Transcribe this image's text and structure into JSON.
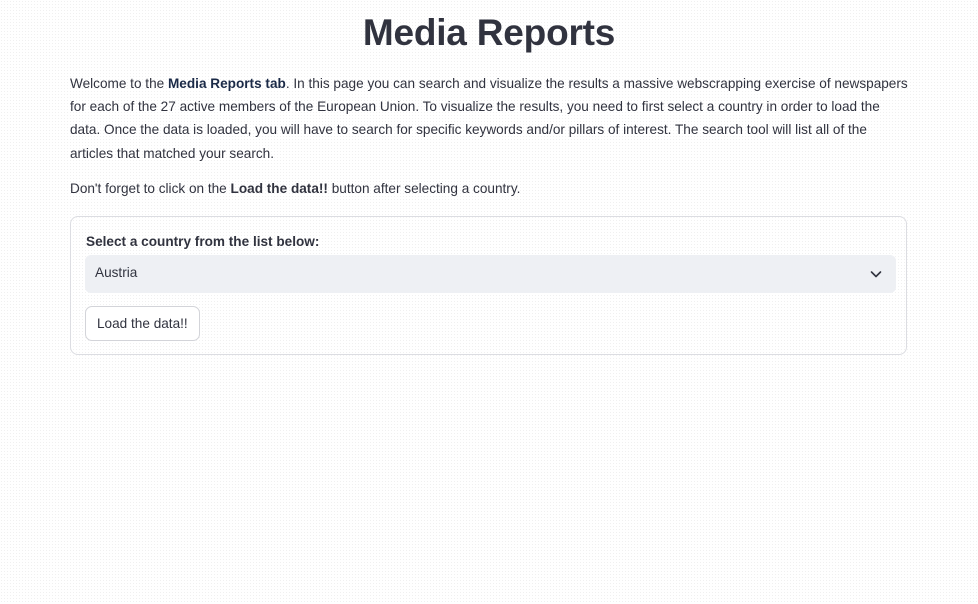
{
  "page": {
    "title": "Media Reports"
  },
  "intro": {
    "text_1": "Welcome to the ",
    "brand": "Media Reports tab",
    "text_2": ". In this page you can search and visualize the results a massive webscrapping exercise of newspapers for each of the 27 active members of the European Union. To visualize the results, you need to first select a country in order to load the data. Once the data is loaded, you will have to search for specific keywords and/or pillars of interest. The search tool will list all of the articles that matched your search."
  },
  "reminder": {
    "text_1": "Don't forget to click on the ",
    "bold": "Load the data!!",
    "text_2": " button after selecting a country."
  },
  "form": {
    "select_label": "Select a country from the list below:",
    "selected_country": "Austria",
    "chevron_icon": "chevron-down-icon",
    "load_button_label": "Load the data!!"
  },
  "colors": {
    "title": "#31333f",
    "brand_text": "#1b2a47",
    "select_background": "#eef0f4",
    "border": "#dcdde2"
  }
}
